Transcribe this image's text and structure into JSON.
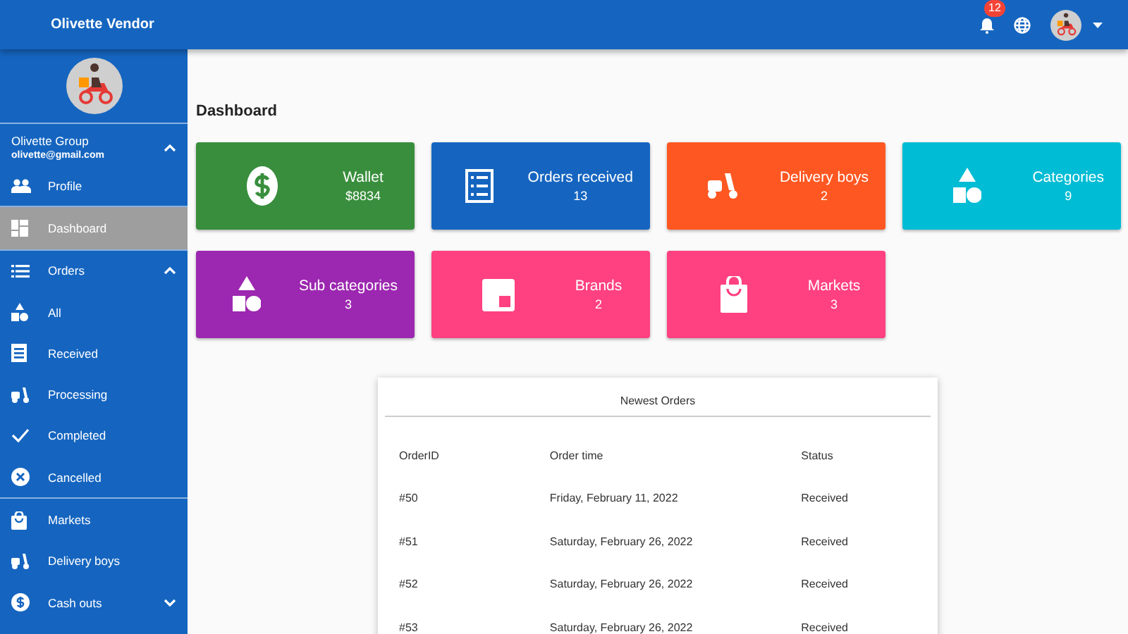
{
  "topbar": {
    "title": "Olivette Vendor",
    "notifications": "12"
  },
  "sidebar": {
    "account": {
      "name": "Olivette Group",
      "email": "olivette@gmail.com",
      "expanded": true
    },
    "items": [
      {
        "label": "Profile",
        "selected": false
      },
      {
        "label": "Dashboard",
        "selected": true
      },
      {
        "label": "Orders",
        "selected": false,
        "expanded": true,
        "children": [
          {
            "label": "All",
            "selected": false
          },
          {
            "label": "Received",
            "selected": false
          },
          {
            "label": "Processing",
            "selected": false
          },
          {
            "label": "Completed",
            "selected": false
          },
          {
            "label": "Cancelled",
            "selected": false
          }
        ]
      },
      {
        "label": "Markets",
        "selected": false
      },
      {
        "label": "Delivery boys",
        "selected": false
      },
      {
        "label": "Cash outs",
        "selected": false,
        "expanded": false
      }
    ]
  },
  "main": {
    "title": "Dashboard",
    "cards": [
      {
        "label": "Wallet",
        "value": "$8834",
        "color": "#388e3c"
      },
      {
        "label": "Orders received",
        "value": "13",
        "color": "#1565c0"
      },
      {
        "label": "Delivery boys",
        "value": "2",
        "color": "#ff5722"
      },
      {
        "label": "Categories",
        "value": "9",
        "color": "#00bcd4"
      },
      {
        "label": "Sub categories",
        "value": "3",
        "color": "#9c27b0"
      },
      {
        "label": "Brands",
        "value": "2",
        "color": "#ff4081"
      },
      {
        "label": "Markets",
        "value": "3",
        "color": "#ff4081"
      }
    ],
    "orders": {
      "title": "Newest Orders",
      "columns": [
        "OrderID",
        "Order time",
        "Status"
      ],
      "rows": [
        [
          "#50",
          "Friday, February 11, 2022",
          "Received"
        ],
        [
          "#51",
          "Saturday, February 26, 2022",
          "Received"
        ],
        [
          "#52",
          "Saturday, February 26, 2022",
          "Received"
        ],
        [
          "#53",
          "Saturday, February 26, 2022",
          "Received"
        ]
      ]
    }
  }
}
